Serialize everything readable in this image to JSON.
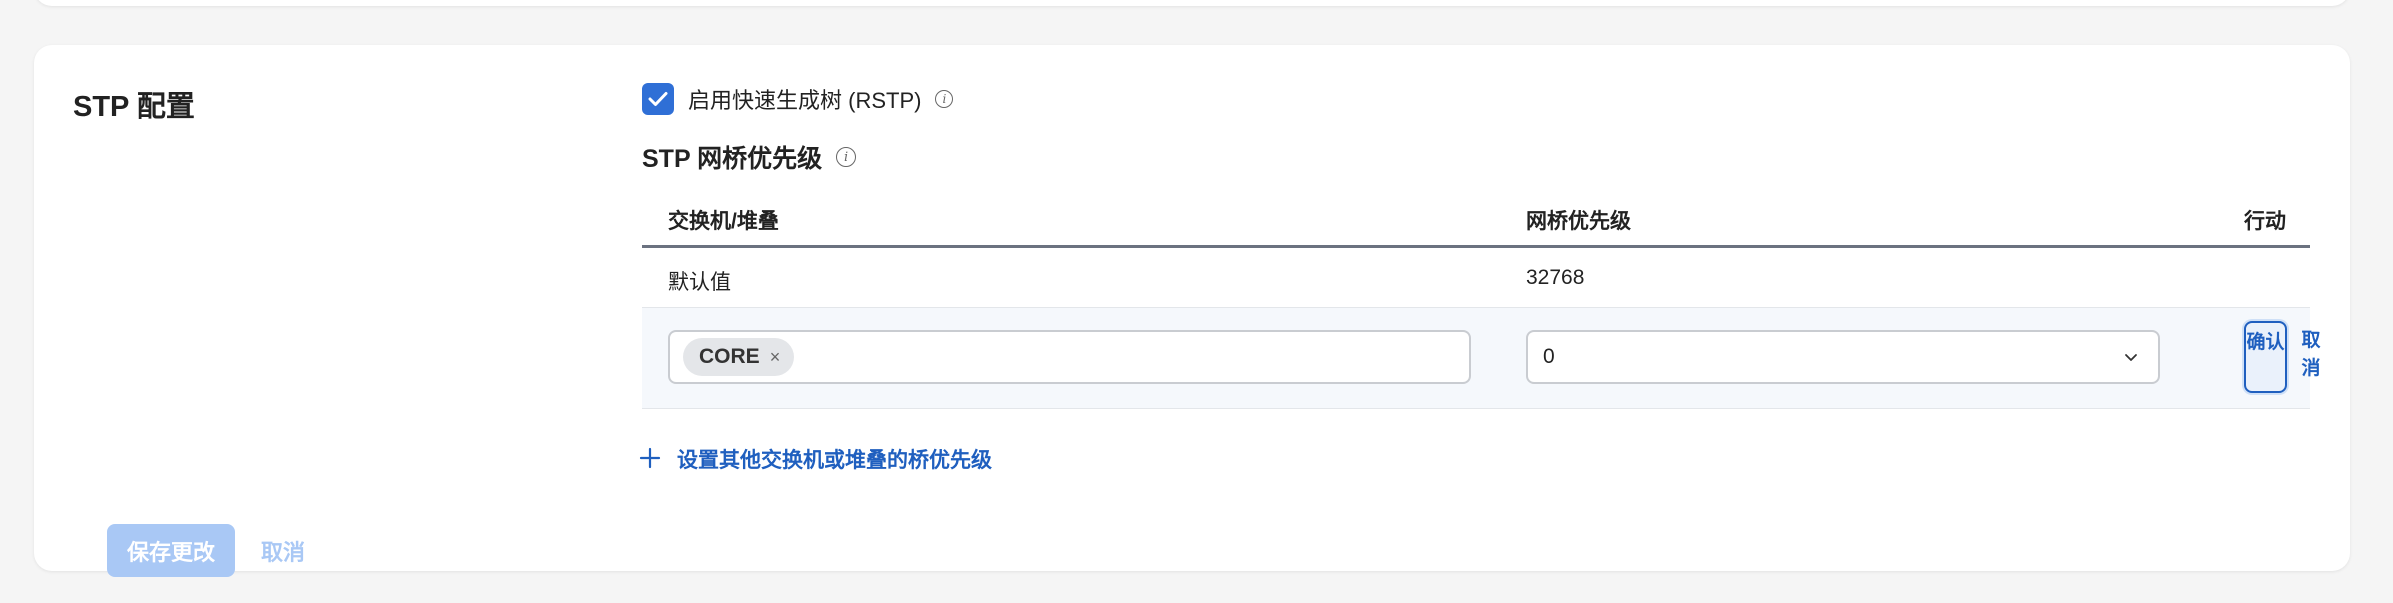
{
  "section": {
    "title": "STP 配置"
  },
  "rstp": {
    "checked": true,
    "label": "启用快速生成树 (RSTP)"
  },
  "bridge_priority": {
    "title": "STP 网桥优先级",
    "columns": {
      "switch": "交换机/堆叠",
      "priority": "网桥优先级",
      "action": "行动"
    },
    "default_row": {
      "switch": "默认值",
      "priority": "32768"
    },
    "edit_row": {
      "chip_label": "CORE",
      "chip_remove": "×",
      "priority_value": "0",
      "confirm_label": "确认",
      "cancel_label": "取消"
    },
    "add_link": "设置其他交换机或堆叠的桥优先级"
  },
  "footer": {
    "save_label": "保存更改",
    "cancel_label": "取消"
  },
  "colors": {
    "accent": "#2f6fd6",
    "link": "#1f5fbf",
    "disabled_button": "#a9c8f5"
  }
}
